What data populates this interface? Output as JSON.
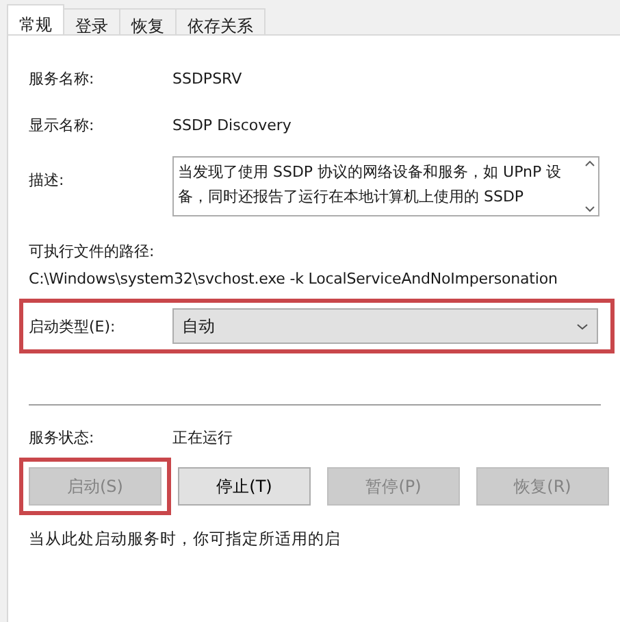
{
  "tabs": [
    {
      "label": "常规",
      "selected": true
    },
    {
      "label": "登录",
      "selected": false
    },
    {
      "label": "恢复",
      "selected": false
    },
    {
      "label": "依存关系",
      "selected": false
    }
  ],
  "service_name": {
    "label": "服务名称:",
    "value": "SSDPSRV"
  },
  "display_name": {
    "label": "显示名称:",
    "value": "SSDP Discovery"
  },
  "description": {
    "label": "描述:",
    "value": "当发现了使用 SSDP 协议的网络设备和服务，如 UPnP 设备，同时还报告了运行在本地计算机上使用的 SSDP"
  },
  "executable_path": {
    "label": "可执行文件的路径:",
    "value": "C:\\Windows\\system32\\svchost.exe -k LocalServiceAndNoImpersonation"
  },
  "startup_type": {
    "label": "启动类型(E):",
    "value": "自动",
    "highlighted": true
  },
  "service_status": {
    "label": "服务状态:",
    "value": "正在运行"
  },
  "buttons": [
    {
      "label": "启动(S)",
      "disabled": true,
      "highlighted": true
    },
    {
      "label": "停止(T)",
      "disabled": false,
      "highlighted": false
    },
    {
      "label": "暂停(P)",
      "disabled": true,
      "highlighted": false
    },
    {
      "label": "恢复(R)",
      "disabled": true,
      "highlighted": false
    }
  ],
  "start_parameters": {
    "label": "当从此处启动服务时，你可指定所适用的启"
  }
}
